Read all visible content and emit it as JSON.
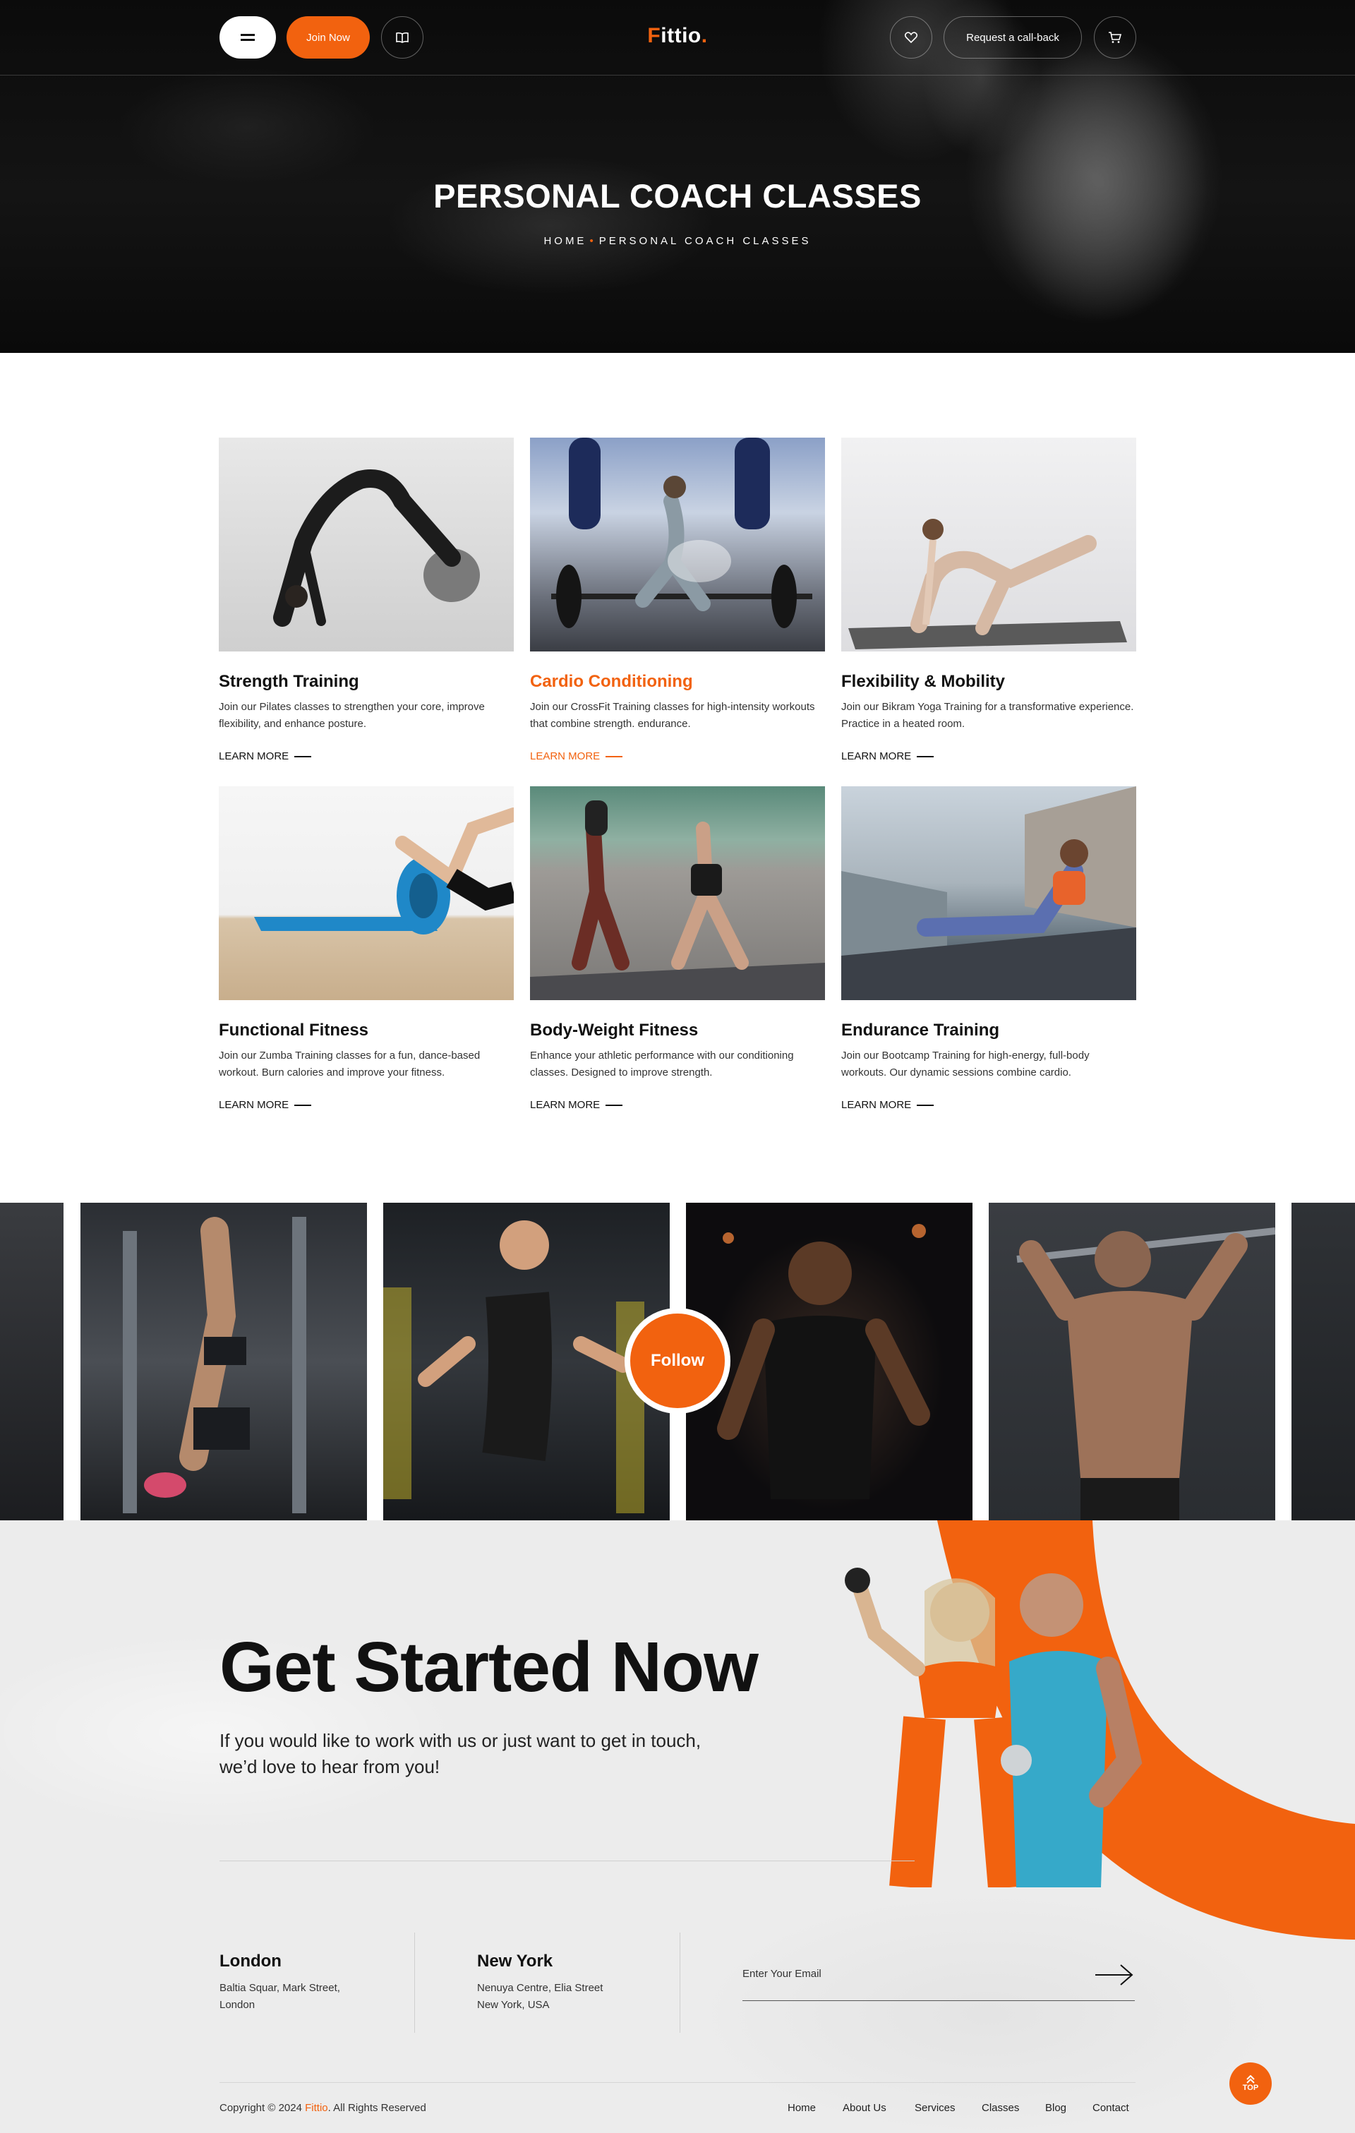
{
  "header": {
    "join_label": "Join Now",
    "logo_first": "F",
    "logo_rest": "ittio",
    "logo_dot": ".",
    "callback_label": "Request a call-back"
  },
  "hero": {
    "title": "PERSONAL COACH CLASSES",
    "breadcrumb_home": "HOME",
    "breadcrumb_sep": "•",
    "breadcrumb_current": "PERSONAL COACH CLASSES"
  },
  "classes": [
    {
      "title": "Strength Training",
      "text": "Join our Pilates classes to strengthen your core, improve flexibility, and enhance posture.",
      "link": "LEARN MORE"
    },
    {
      "title": "Cardio Conditioning",
      "text": "Join our CrossFit Training classes for high-intensity workouts that combine strength. endurance.",
      "link": "LEARN MORE"
    },
    {
      "title": "Flexibility & Mobility",
      "text": "Join our Bikram Yoga Training for a transformative experience. Practice in a heated room.",
      "link": "LEARN MORE"
    },
    {
      "title": "Functional Fitness",
      "text": "Join our Zumba Training classes for a fun, dance-based workout. Burn calories and improve your fitness.",
      "link": "LEARN MORE"
    },
    {
      "title": "Body-Weight Fitness",
      "text": "Enhance your athletic performance with our conditioning classes. Designed to improve strength.",
      "link": "LEARN MORE"
    },
    {
      "title": "Endurance Training",
      "text": "Join our Bootcamp Training for high-energy, full-body workouts. Our dynamic sessions combine cardio.",
      "link": "LEARN MORE"
    }
  ],
  "gallery": {
    "follow_label": "Follow"
  },
  "cta": {
    "title": "Get Started Now",
    "subtitle": "If you would like to work with us or just want to get in touch, we’d love to hear from you!"
  },
  "offices": [
    {
      "city": "London",
      "line1": "Baltia Squar, Mark Street,",
      "line2": "London"
    },
    {
      "city": "New York",
      "line1": "Nenuya Centre, Elia Street",
      "line2": "New York, USA"
    }
  ],
  "newsletter": {
    "placeholder": "Enter Your Email"
  },
  "footer": {
    "copyright_prefix": "Copyright © 2024",
    "copyright_brand": "Fittio",
    "copyright_suffix": ". All Rights Reserved",
    "nav": [
      "Home",
      "About Us",
      "Services",
      "Classes",
      "Blog",
      "Contact"
    ],
    "top_label": "TOP"
  },
  "colors": {
    "accent": "#f2620f",
    "dark": "#111111",
    "light_bg": "#ececec"
  }
}
